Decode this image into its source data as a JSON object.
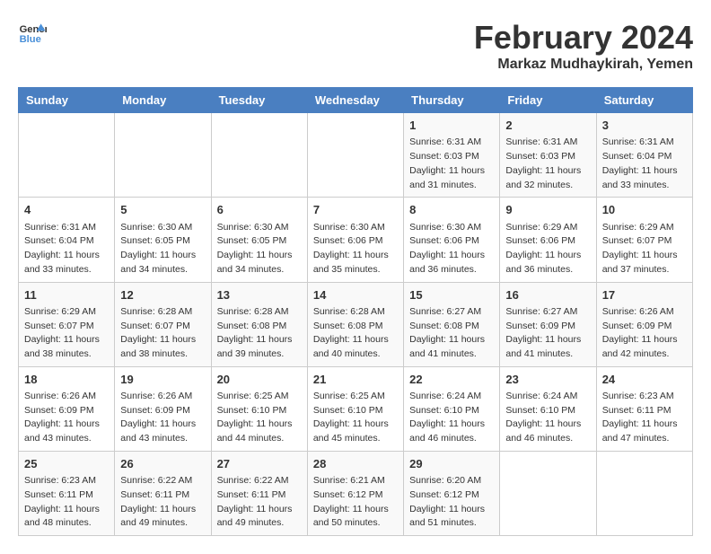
{
  "header": {
    "logo_line1": "General",
    "logo_line2": "Blue",
    "month": "February 2024",
    "location": "Markaz Mudhaykirah, Yemen"
  },
  "weekdays": [
    "Sunday",
    "Monday",
    "Tuesday",
    "Wednesday",
    "Thursday",
    "Friday",
    "Saturday"
  ],
  "weeks": [
    [
      {
        "day": "",
        "sunrise": "",
        "sunset": "",
        "daylight": ""
      },
      {
        "day": "",
        "sunrise": "",
        "sunset": "",
        "daylight": ""
      },
      {
        "day": "",
        "sunrise": "",
        "sunset": "",
        "daylight": ""
      },
      {
        "day": "",
        "sunrise": "",
        "sunset": "",
        "daylight": ""
      },
      {
        "day": "1",
        "sunrise": "Sunrise: 6:31 AM",
        "sunset": "Sunset: 6:03 PM",
        "daylight": "Daylight: 11 hours and 31 minutes."
      },
      {
        "day": "2",
        "sunrise": "Sunrise: 6:31 AM",
        "sunset": "Sunset: 6:03 PM",
        "daylight": "Daylight: 11 hours and 32 minutes."
      },
      {
        "day": "3",
        "sunrise": "Sunrise: 6:31 AM",
        "sunset": "Sunset: 6:04 PM",
        "daylight": "Daylight: 11 hours and 33 minutes."
      }
    ],
    [
      {
        "day": "4",
        "sunrise": "Sunrise: 6:31 AM",
        "sunset": "Sunset: 6:04 PM",
        "daylight": "Daylight: 11 hours and 33 minutes."
      },
      {
        "day": "5",
        "sunrise": "Sunrise: 6:30 AM",
        "sunset": "Sunset: 6:05 PM",
        "daylight": "Daylight: 11 hours and 34 minutes."
      },
      {
        "day": "6",
        "sunrise": "Sunrise: 6:30 AM",
        "sunset": "Sunset: 6:05 PM",
        "daylight": "Daylight: 11 hours and 34 minutes."
      },
      {
        "day": "7",
        "sunrise": "Sunrise: 6:30 AM",
        "sunset": "Sunset: 6:06 PM",
        "daylight": "Daylight: 11 hours and 35 minutes."
      },
      {
        "day": "8",
        "sunrise": "Sunrise: 6:30 AM",
        "sunset": "Sunset: 6:06 PM",
        "daylight": "Daylight: 11 hours and 36 minutes."
      },
      {
        "day": "9",
        "sunrise": "Sunrise: 6:29 AM",
        "sunset": "Sunset: 6:06 PM",
        "daylight": "Daylight: 11 hours and 36 minutes."
      },
      {
        "day": "10",
        "sunrise": "Sunrise: 6:29 AM",
        "sunset": "Sunset: 6:07 PM",
        "daylight": "Daylight: 11 hours and 37 minutes."
      }
    ],
    [
      {
        "day": "11",
        "sunrise": "Sunrise: 6:29 AM",
        "sunset": "Sunset: 6:07 PM",
        "daylight": "Daylight: 11 hours and 38 minutes."
      },
      {
        "day": "12",
        "sunrise": "Sunrise: 6:28 AM",
        "sunset": "Sunset: 6:07 PM",
        "daylight": "Daylight: 11 hours and 38 minutes."
      },
      {
        "day": "13",
        "sunrise": "Sunrise: 6:28 AM",
        "sunset": "Sunset: 6:08 PM",
        "daylight": "Daylight: 11 hours and 39 minutes."
      },
      {
        "day": "14",
        "sunrise": "Sunrise: 6:28 AM",
        "sunset": "Sunset: 6:08 PM",
        "daylight": "Daylight: 11 hours and 40 minutes."
      },
      {
        "day": "15",
        "sunrise": "Sunrise: 6:27 AM",
        "sunset": "Sunset: 6:08 PM",
        "daylight": "Daylight: 11 hours and 41 minutes."
      },
      {
        "day": "16",
        "sunrise": "Sunrise: 6:27 AM",
        "sunset": "Sunset: 6:09 PM",
        "daylight": "Daylight: 11 hours and 41 minutes."
      },
      {
        "day": "17",
        "sunrise": "Sunrise: 6:26 AM",
        "sunset": "Sunset: 6:09 PM",
        "daylight": "Daylight: 11 hours and 42 minutes."
      }
    ],
    [
      {
        "day": "18",
        "sunrise": "Sunrise: 6:26 AM",
        "sunset": "Sunset: 6:09 PM",
        "daylight": "Daylight: 11 hours and 43 minutes."
      },
      {
        "day": "19",
        "sunrise": "Sunrise: 6:26 AM",
        "sunset": "Sunset: 6:09 PM",
        "daylight": "Daylight: 11 hours and 43 minutes."
      },
      {
        "day": "20",
        "sunrise": "Sunrise: 6:25 AM",
        "sunset": "Sunset: 6:10 PM",
        "daylight": "Daylight: 11 hours and 44 minutes."
      },
      {
        "day": "21",
        "sunrise": "Sunrise: 6:25 AM",
        "sunset": "Sunset: 6:10 PM",
        "daylight": "Daylight: 11 hours and 45 minutes."
      },
      {
        "day": "22",
        "sunrise": "Sunrise: 6:24 AM",
        "sunset": "Sunset: 6:10 PM",
        "daylight": "Daylight: 11 hours and 46 minutes."
      },
      {
        "day": "23",
        "sunrise": "Sunrise: 6:24 AM",
        "sunset": "Sunset: 6:10 PM",
        "daylight": "Daylight: 11 hours and 46 minutes."
      },
      {
        "day": "24",
        "sunrise": "Sunrise: 6:23 AM",
        "sunset": "Sunset: 6:11 PM",
        "daylight": "Daylight: 11 hours and 47 minutes."
      }
    ],
    [
      {
        "day": "25",
        "sunrise": "Sunrise: 6:23 AM",
        "sunset": "Sunset: 6:11 PM",
        "daylight": "Daylight: 11 hours and 48 minutes."
      },
      {
        "day": "26",
        "sunrise": "Sunrise: 6:22 AM",
        "sunset": "Sunset: 6:11 PM",
        "daylight": "Daylight: 11 hours and 49 minutes."
      },
      {
        "day": "27",
        "sunrise": "Sunrise: 6:22 AM",
        "sunset": "Sunset: 6:11 PM",
        "daylight": "Daylight: 11 hours and 49 minutes."
      },
      {
        "day": "28",
        "sunrise": "Sunrise: 6:21 AM",
        "sunset": "Sunset: 6:12 PM",
        "daylight": "Daylight: 11 hours and 50 minutes."
      },
      {
        "day": "29",
        "sunrise": "Sunrise: 6:20 AM",
        "sunset": "Sunset: 6:12 PM",
        "daylight": "Daylight: 11 hours and 51 minutes."
      },
      {
        "day": "",
        "sunrise": "",
        "sunset": "",
        "daylight": ""
      },
      {
        "day": "",
        "sunrise": "",
        "sunset": "",
        "daylight": ""
      }
    ]
  ]
}
